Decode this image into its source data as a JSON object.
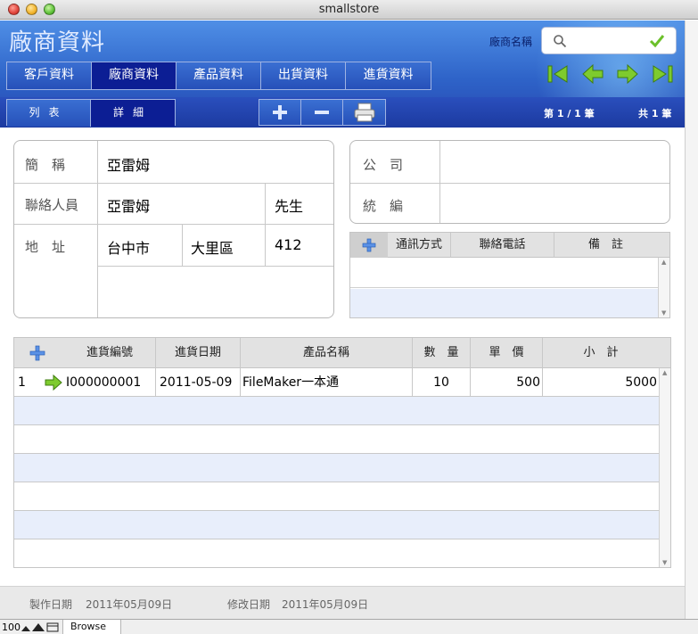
{
  "window": {
    "title": "smallstore"
  },
  "header": {
    "page_title": "廠商資料",
    "search_label": "廠商名稱",
    "search_value": ""
  },
  "tabs": [
    {
      "label": "客戶資料",
      "active": false
    },
    {
      "label": "廠商資料",
      "active": true
    },
    {
      "label": "產品資料",
      "active": false
    },
    {
      "label": "出貨資料",
      "active": false
    },
    {
      "label": "進貨資料",
      "active": false
    }
  ],
  "view_tabs": [
    {
      "label": "列表",
      "active": false
    },
    {
      "label": "詳細",
      "active": true
    }
  ],
  "record_nav": {
    "position": "第 1 / 1 筆",
    "total": "共 1 筆",
    "buttons": [
      "first-record-icon",
      "previous-record-icon",
      "next-record-icon",
      "last-record-icon"
    ]
  },
  "vendor": {
    "labels": {
      "short_name": "簡　稱",
      "contact": "聯絡人員",
      "address": "地　址",
      "company": "公　司",
      "tax_id": "統　編"
    },
    "short_name": "亞雷姆",
    "contact_name": "亞雷姆",
    "contact_title": "先生",
    "city": "台中市",
    "district": "大里區",
    "zip": "412",
    "company": "",
    "tax_id": ""
  },
  "contacts_portal": {
    "headers": [
      "通訊方式",
      "聯絡電話",
      "備　註"
    ],
    "rows": []
  },
  "orders_portal": {
    "headers": [
      "進貨編號",
      "進貨日期",
      "產品名稱",
      "數　量",
      "單　價",
      "小　計"
    ],
    "rows": [
      {
        "index": "1",
        "order_no": "I000000001",
        "date": "2011-05-09",
        "product": "FileMaker一本通",
        "qty": "10",
        "price": "500",
        "subtotal": "5000"
      }
    ]
  },
  "footer": {
    "created_label": "製作日期",
    "created_value": "2011年05月09日",
    "modified_label": "修改日期",
    "modified_value": "2011年05月09日"
  },
  "statusbar": {
    "zoom": "100",
    "mode": "Browse"
  },
  "colors": {
    "header_blue": "#2e63c8",
    "active_tab": "#0c1e94",
    "nav_green": "#7ecb2e",
    "row_alt": "#e8eefb"
  }
}
